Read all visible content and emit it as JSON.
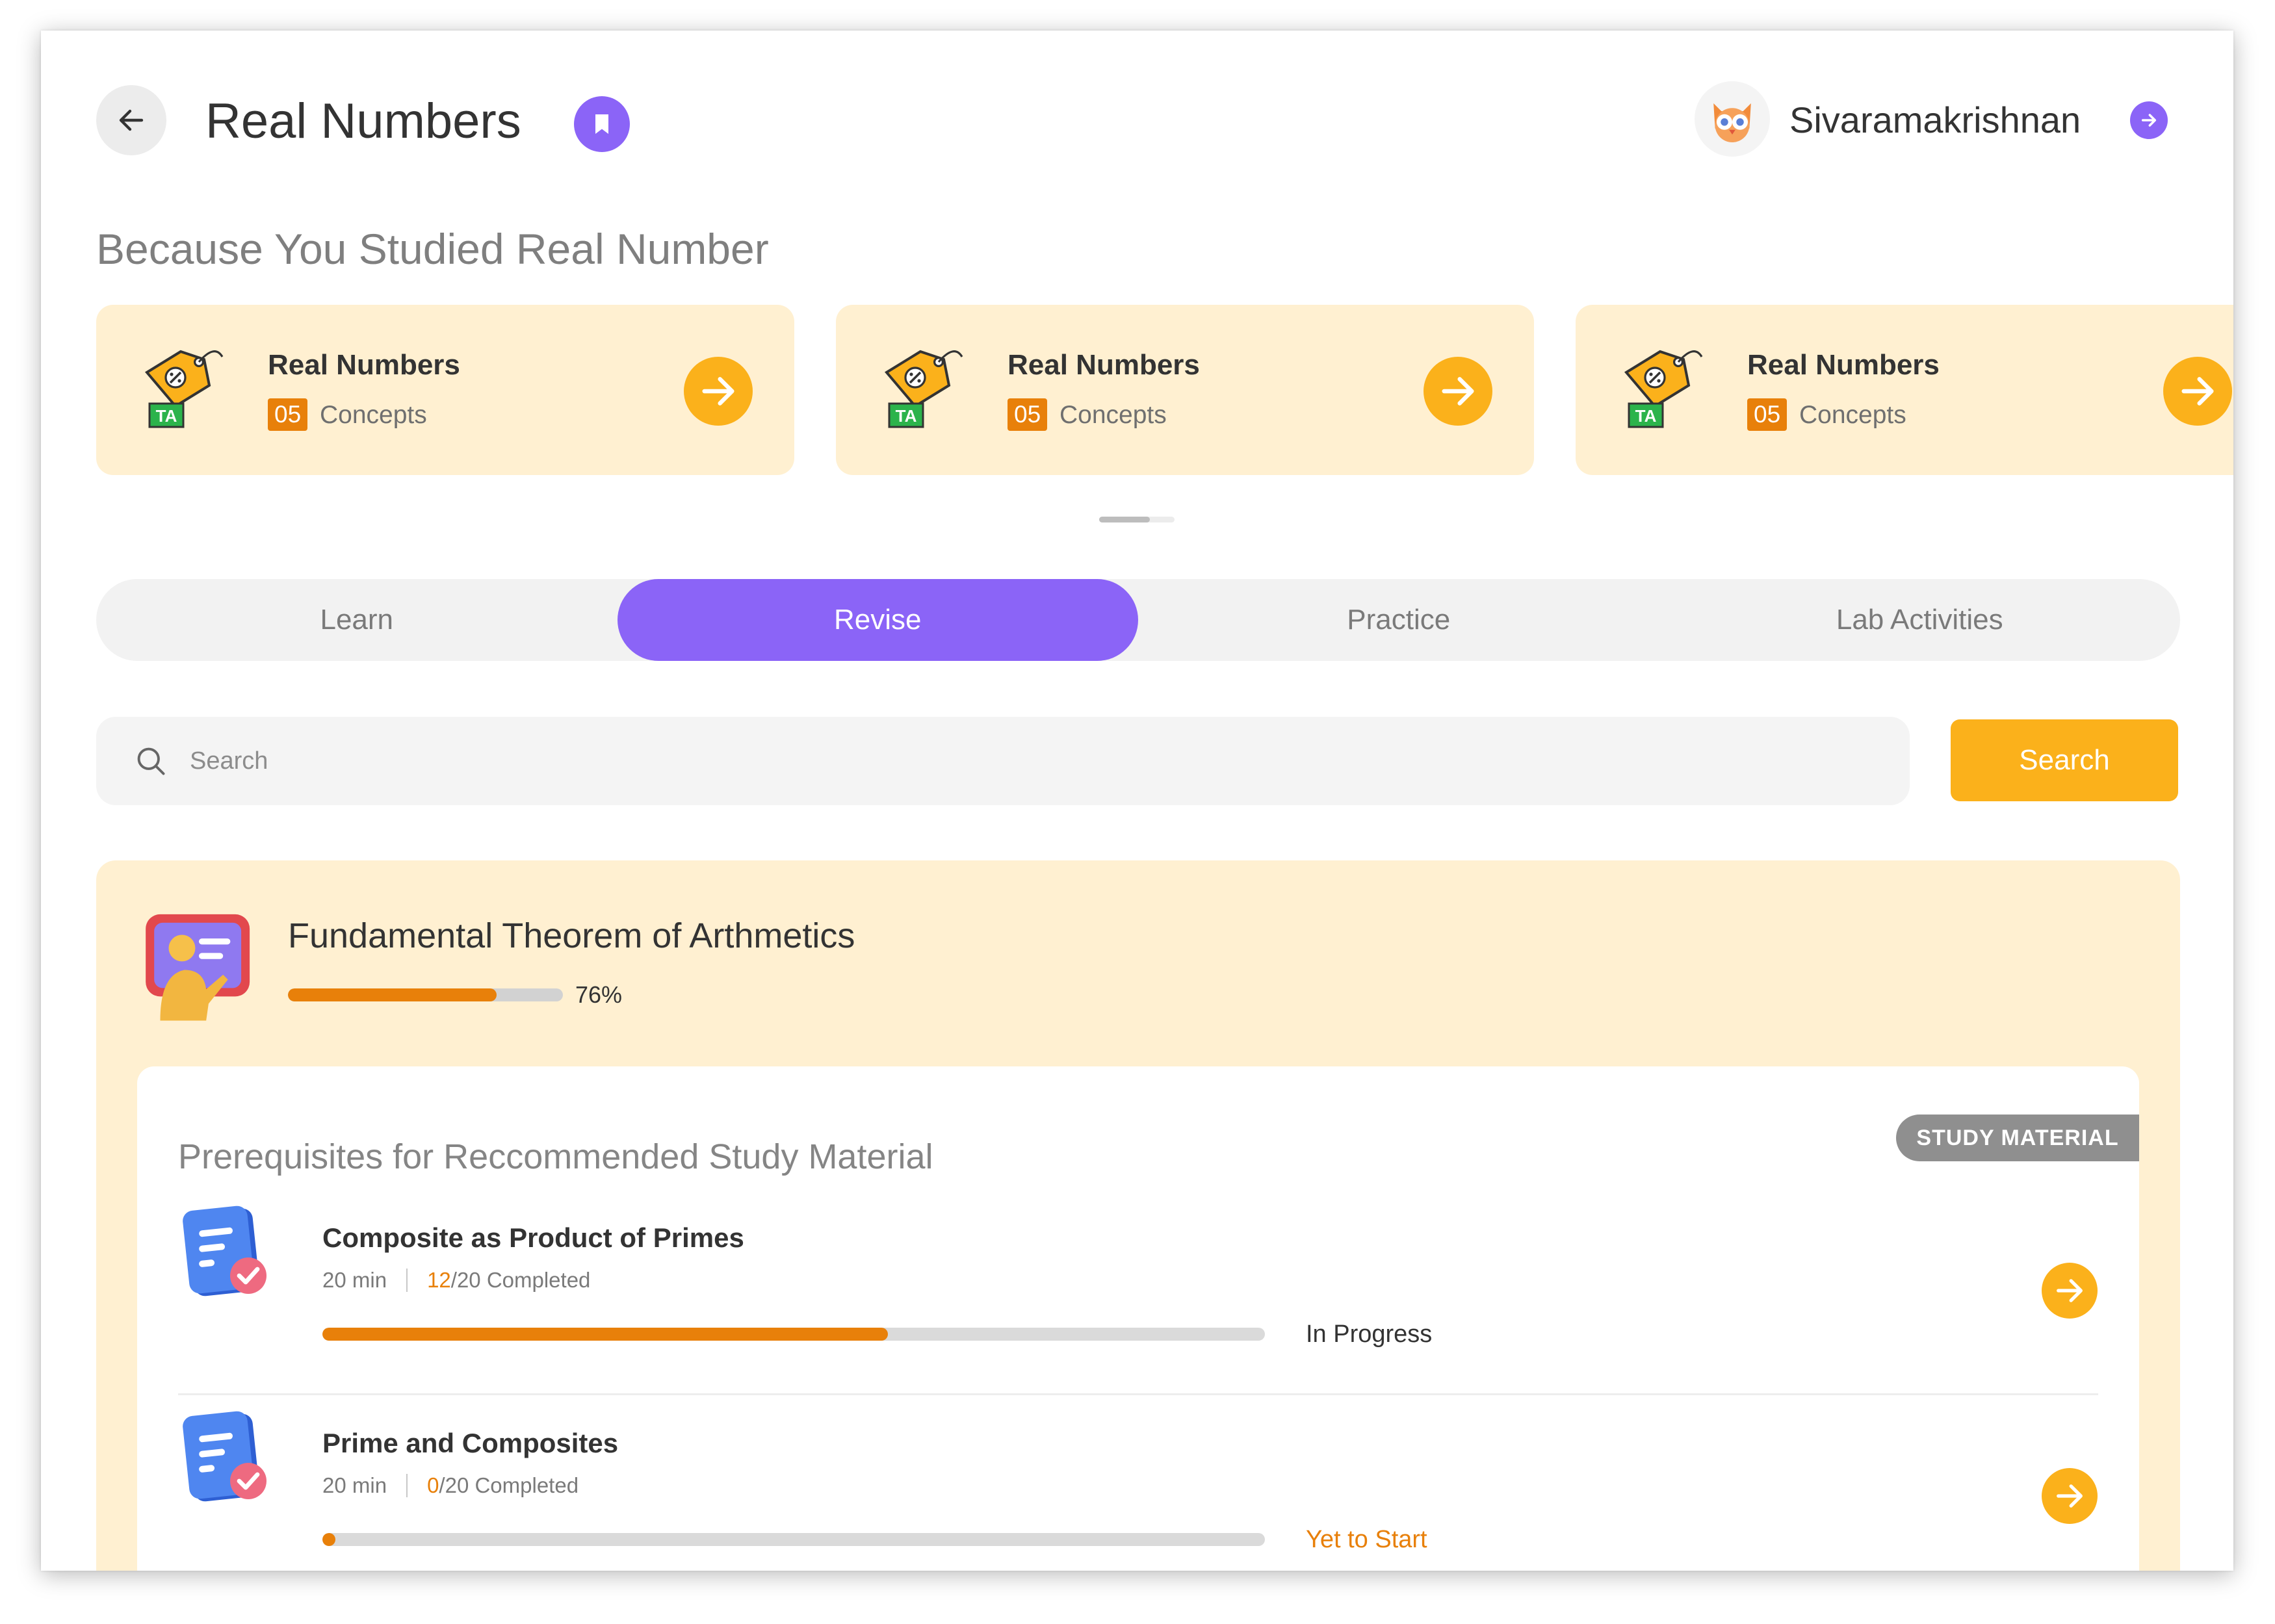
{
  "header": {
    "title": "Real Numbers",
    "user_name": "Sivaramakrishnan"
  },
  "recommendations": {
    "heading": "Because You Studied Real Number",
    "icon_badge": "TA",
    "cards": [
      {
        "title": "Real Numbers",
        "count": "05",
        "count_label": "Concepts"
      },
      {
        "title": "Real Numbers",
        "count": "05",
        "count_label": "Concepts"
      },
      {
        "title": "Real Numbers",
        "count": "05",
        "count_label": "Concepts"
      }
    ]
  },
  "tabs": [
    {
      "label": "Learn",
      "active": false
    },
    {
      "label": "Revise",
      "active": true
    },
    {
      "label": "Practice",
      "active": false
    },
    {
      "label": "Lab Activities",
      "active": false
    }
  ],
  "search": {
    "placeholder": "Search",
    "value": "",
    "button_label": "Search"
  },
  "topic": {
    "title": "Fundamental Theorem of Arthmetics",
    "progress": 0.76,
    "progress_label": "76%"
  },
  "study_material": {
    "heading": "Prerequisites for Reccommended Study Material",
    "badge": "STUDY MATERIAL",
    "items": [
      {
        "title": "Composite as Product of Primes",
        "duration": "20 min",
        "completed": "12",
        "total_label": "/20 Completed",
        "progress": 0.6,
        "status": "In Progress",
        "status_color": "#333333"
      },
      {
        "title": "Prime and Composites",
        "duration": "20 min",
        "completed": "0",
        "total_label": "/20 Completed",
        "progress": 0,
        "status": "Yet to Start",
        "status_color": "#e8800a"
      }
    ]
  },
  "colors": {
    "accent_purple": "#8b64f7",
    "accent_yellow": "#fbb11b",
    "accent_orange": "#e8800a",
    "card_cream": "#fff0d1"
  },
  "icons": {
    "back": "arrow-left-icon",
    "bookmark": "bookmark-icon",
    "avatar": "owl-avatar-icon",
    "card_arrow": "arrow-right-icon",
    "search": "search-icon",
    "topic": "teacher-board-icon",
    "material": "document-check-icon"
  }
}
